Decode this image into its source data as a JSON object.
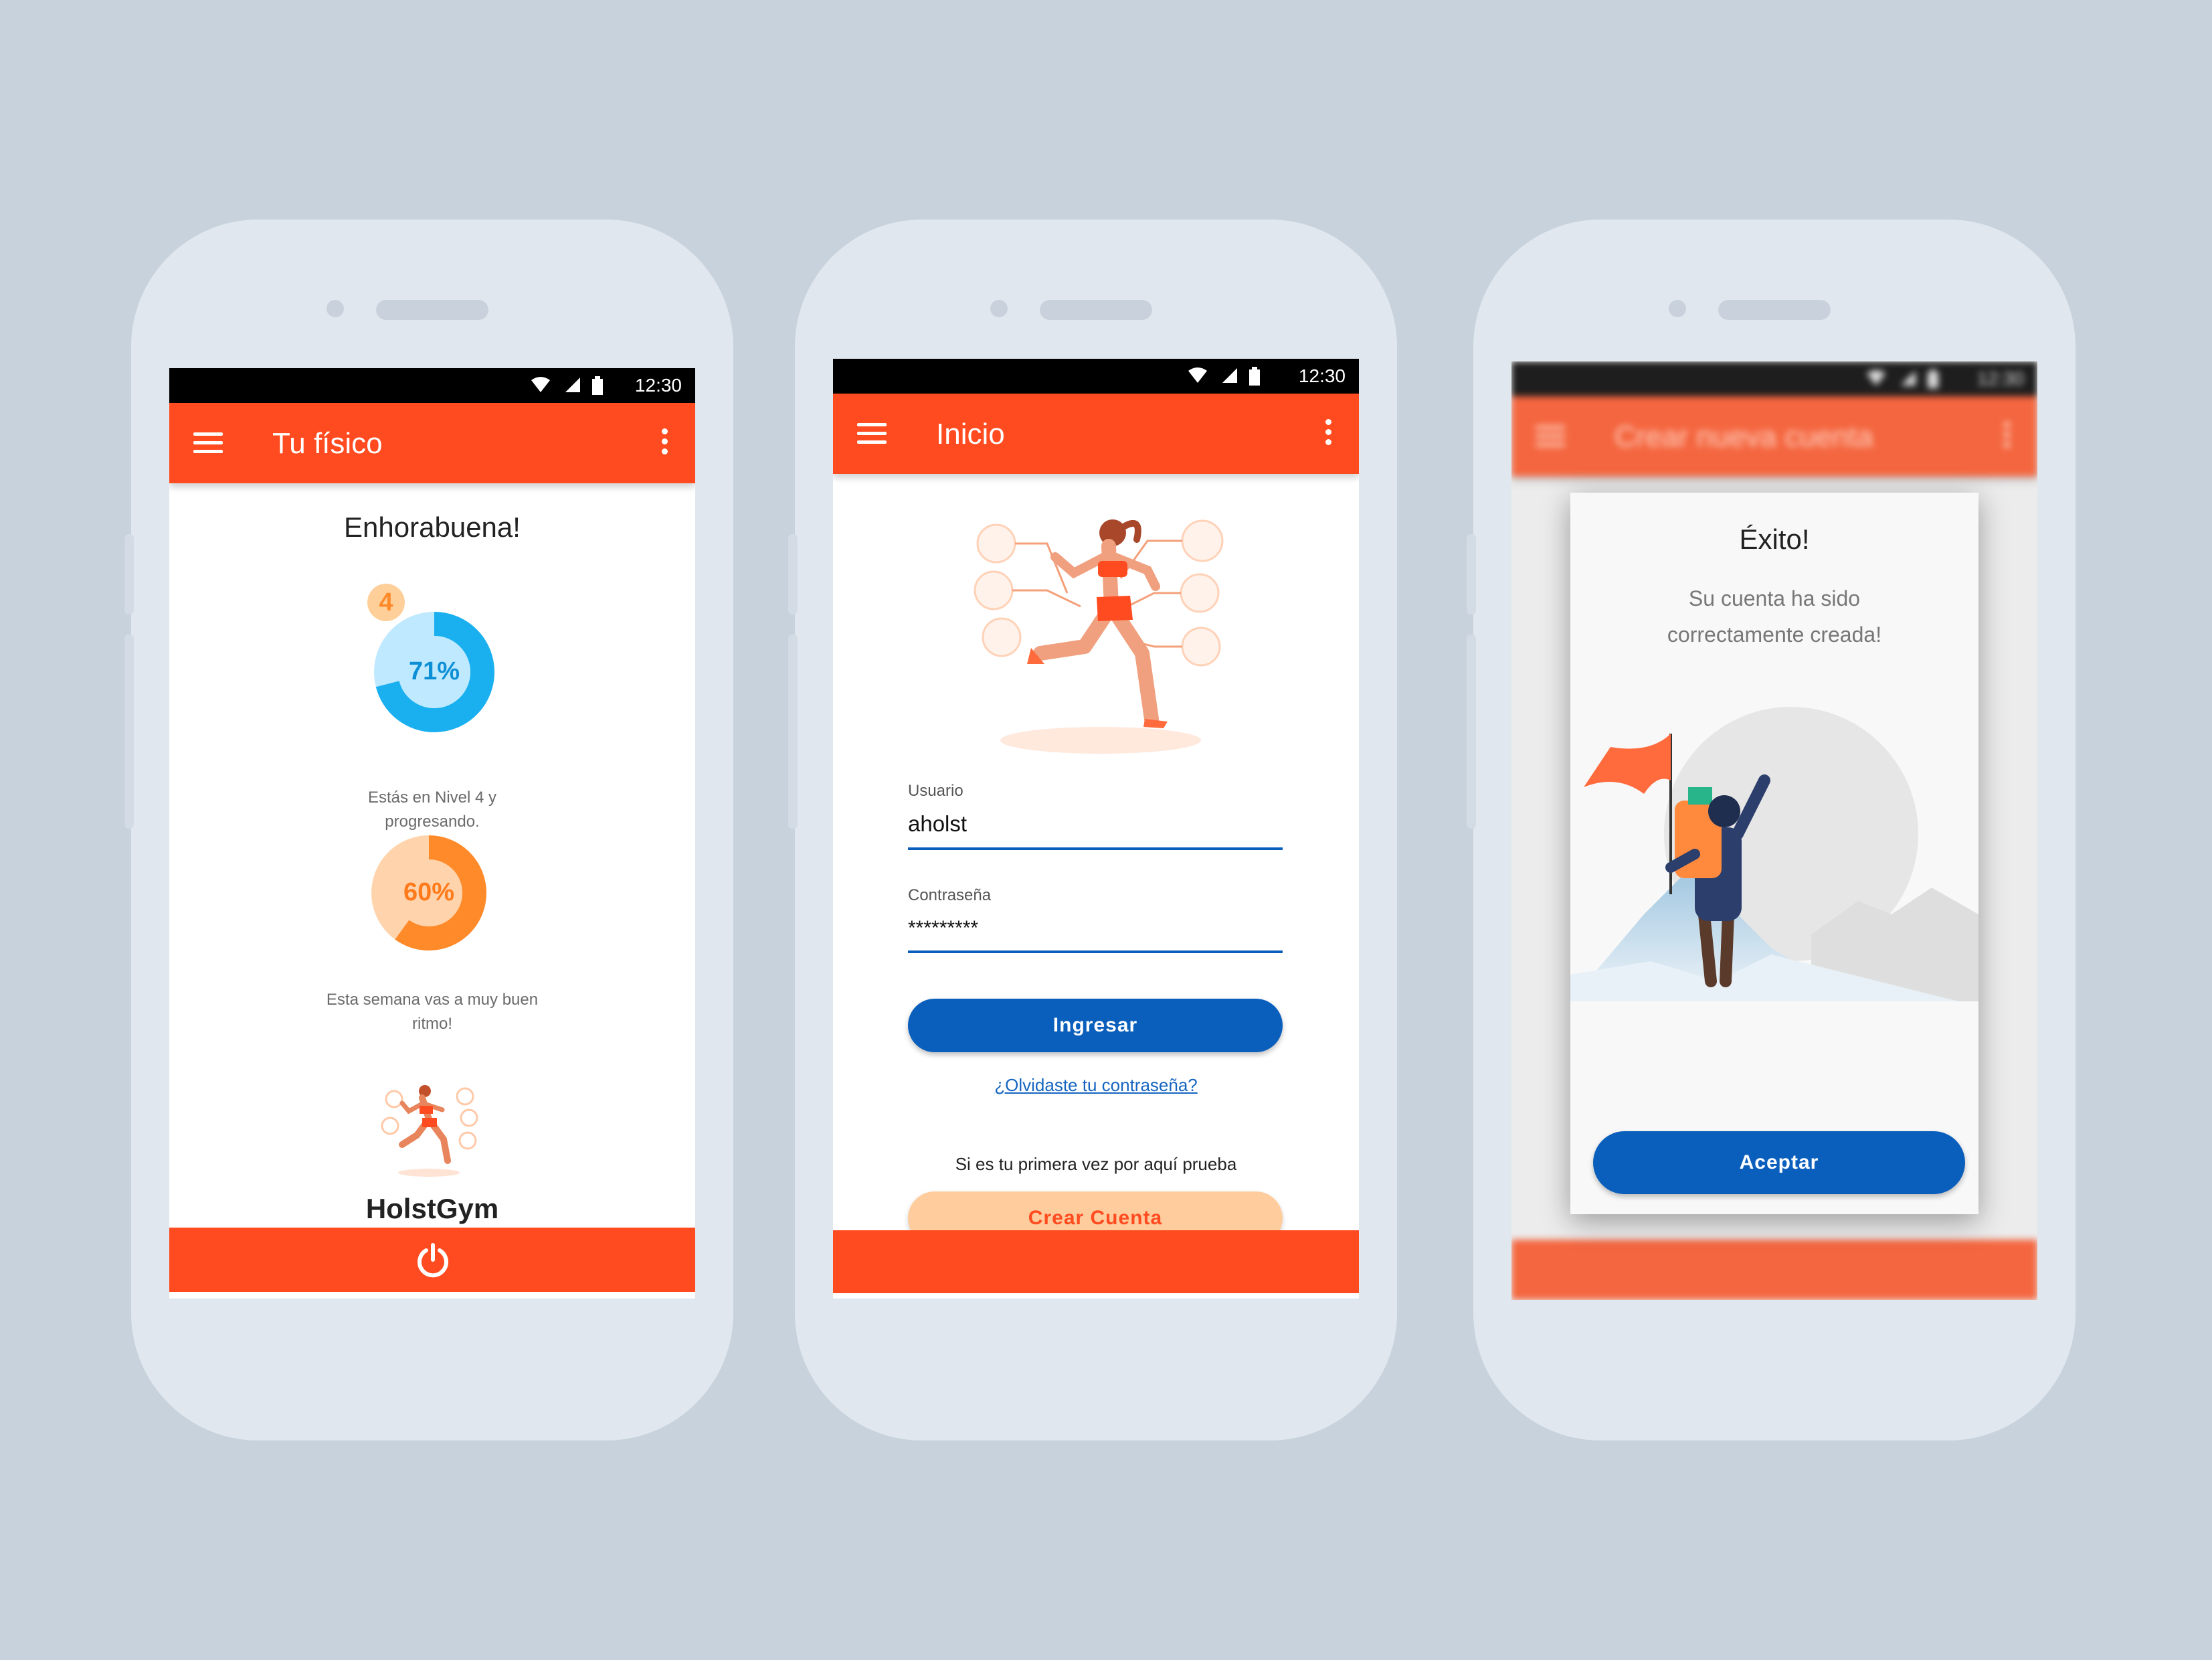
{
  "status_bar": {
    "time": "12:30"
  },
  "screen1": {
    "app_title": "Tu físico",
    "congrats": "Enhorabuena!",
    "level_badge": "4",
    "level_percent": "71%",
    "level_progress": 0.71,
    "level_text_1": "Estás en Nivel 4 y",
    "level_text_2": "progresando.",
    "week_percent": "60%",
    "week_progress": 0.6,
    "week_text_1": "Esta semana vas a muy buen",
    "week_text_2": "ritmo!",
    "brand": "HolstGym",
    "power_icon": "power-icon"
  },
  "screen2": {
    "app_title": "Inicio",
    "user_label": "Usuario",
    "user_value": "aholst",
    "pass_label": "Contraseña",
    "pass_value": "*********",
    "login_button": "Ingresar",
    "forgot_link": "¿Olvidaste tu contraseña?",
    "first_time_text": "Si es tu primera vez por aquí prueba",
    "create_button": "Crear Cuenta"
  },
  "screen3": {
    "app_title": "Crear nueva cuenta",
    "dialog_title": "Éxito!",
    "dialog_line_1": "Su cuenta ha sido",
    "dialog_line_2": "correctamente creada!",
    "accept_button": "Aceptar"
  },
  "colors": {
    "accent": "#ff4b1f",
    "primary_blue": "#0a5fbd",
    "level_ring": "#1ab0f0",
    "week_ring": "#ff8a2a",
    "create_button_bg": "#ffcc9e"
  }
}
